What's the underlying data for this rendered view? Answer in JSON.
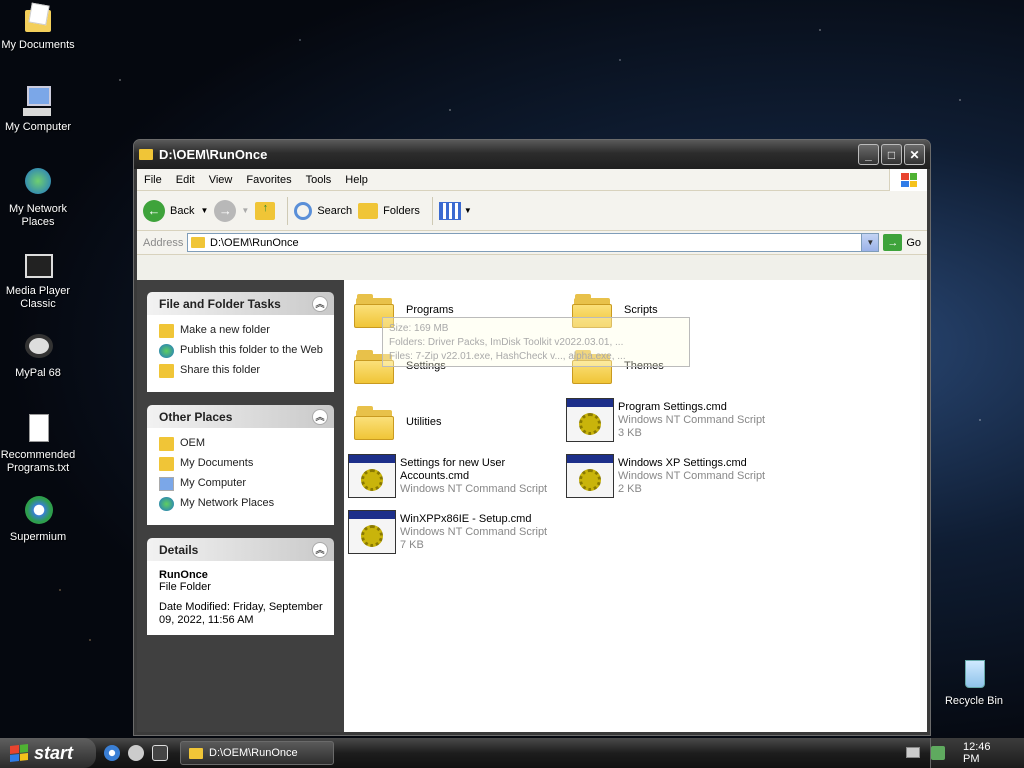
{
  "desktop": {
    "icons": [
      {
        "label": "My Documents",
        "icon": "my-documents-icon"
      },
      {
        "label": "My Computer",
        "icon": "my-computer-icon"
      },
      {
        "label": "My Network Places",
        "icon": "network-places-icon"
      },
      {
        "label": "Media Player Classic",
        "icon": "media-player-icon"
      },
      {
        "label": "MyPal 68",
        "icon": "mypal-icon"
      },
      {
        "label": "Recommended Programs.txt",
        "icon": "text-file-icon"
      },
      {
        "label": "Supermium",
        "icon": "supermium-icon"
      },
      {
        "label": "Recycle Bin",
        "icon": "recycle-bin-icon"
      }
    ]
  },
  "window": {
    "title": "D:\\OEM\\RunOnce",
    "menu": [
      "File",
      "Edit",
      "View",
      "Favorites",
      "Tools",
      "Help"
    ],
    "toolbar": {
      "back": "Back",
      "search": "Search",
      "folders": "Folders"
    },
    "address": {
      "label": "Address",
      "value": "D:\\OEM\\RunOnce",
      "go": "Go"
    }
  },
  "tasks": {
    "file_folder": {
      "title": "File and Folder Tasks",
      "items": [
        "Make a new folder",
        "Publish this folder to the Web",
        "Share this folder"
      ]
    },
    "other_places": {
      "title": "Other Places",
      "items": [
        "OEM",
        "My Documents",
        "My Computer",
        "My Network Places"
      ]
    },
    "details": {
      "title": "Details",
      "name": "RunOnce",
      "type": "File Folder",
      "modified": "Date Modified: Friday, September 09, 2022, 11:56 AM"
    }
  },
  "files": [
    {
      "name": "Programs",
      "kind": "folder"
    },
    {
      "name": "Scripts",
      "kind": "folder"
    },
    {
      "name": "Settings",
      "kind": "folder"
    },
    {
      "name": "Themes",
      "kind": "folder"
    },
    {
      "name": "Utilities",
      "kind": "folder"
    },
    {
      "name": "Program Settings.cmd",
      "type": "Windows NT Command Script",
      "size": "3 KB",
      "kind": "cmd"
    },
    {
      "name": "Settings for new User Accounts.cmd",
      "type": "Windows NT Command Script",
      "size": "",
      "kind": "cmd"
    },
    {
      "name": "Windows XP Settings.cmd",
      "type": "Windows NT Command Script",
      "size": "2 KB",
      "kind": "cmd"
    },
    {
      "name": "WinXPPx86IE - Setup.cmd",
      "type": "Windows NT Command Script",
      "size": "7 KB",
      "kind": "cmd"
    }
  ],
  "tooltip": {
    "line1": "Size: 169 MB",
    "line2": "Folders: Driver Packs, ImDisk Toolkit v2022.03.01, ...",
    "line3": "Files: 7-Zip v22.01.exe, HashCheck v..., alpha.exe, ..."
  },
  "taskbar": {
    "start": "start",
    "active_window": "D:\\OEM\\RunOnce",
    "clock": "12:46 PM"
  }
}
